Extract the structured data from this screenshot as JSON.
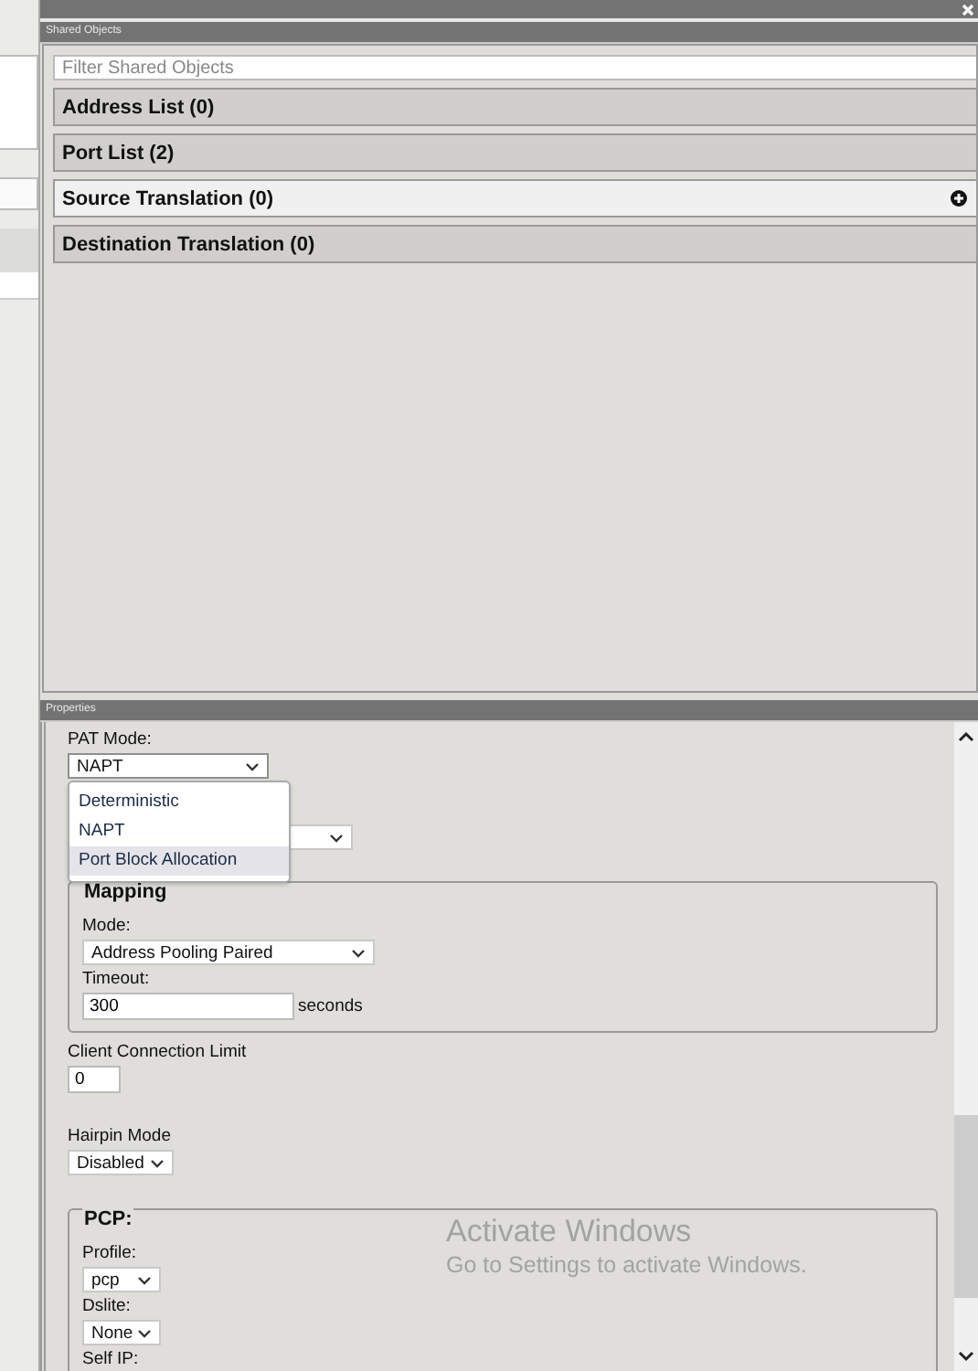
{
  "shared_objects": {
    "title": "Shared Objects",
    "filter": {
      "placeholder": "Filter Shared Objects"
    },
    "sections": [
      {
        "label": "Address List (0)",
        "hovered": false
      },
      {
        "label": "Port List (2)",
        "hovered": false
      },
      {
        "label": "Source Translation (0)",
        "hovered": true
      },
      {
        "label": "Destination Translation (0)",
        "hovered": false
      }
    ]
  },
  "properties": {
    "title": "Properties",
    "pat_mode": {
      "label": "PAT Mode:",
      "value": "NAPT",
      "expanded": true,
      "options": [
        {
          "label": "Deterministic",
          "highlighted": false
        },
        {
          "label": "NAPT",
          "highlighted": false
        },
        {
          "label": "Port Block Allocation",
          "highlighted": true
        }
      ]
    },
    "mapping": {
      "legend": "Mapping",
      "mode_label": "Mode:",
      "mode_value": "Address Pooling Paired",
      "timeout_label": "Timeout:",
      "timeout_value": "300",
      "timeout_unit": "seconds"
    },
    "client_connection_limit": {
      "label": "Client Connection Limit",
      "value": "0"
    },
    "hairpin_mode": {
      "label": "Hairpin Mode",
      "value": "Disabled"
    },
    "pcp": {
      "legend": "PCP:",
      "profile_label": "Profile:",
      "profile_value": "pcp",
      "dslite_label": "Dslite:",
      "dslite_value": "None",
      "self_ip_label": "Self IP:"
    }
  },
  "activation_notice": {
    "title": "Activate Windows",
    "message": "Go to Settings to activate Windows."
  }
}
